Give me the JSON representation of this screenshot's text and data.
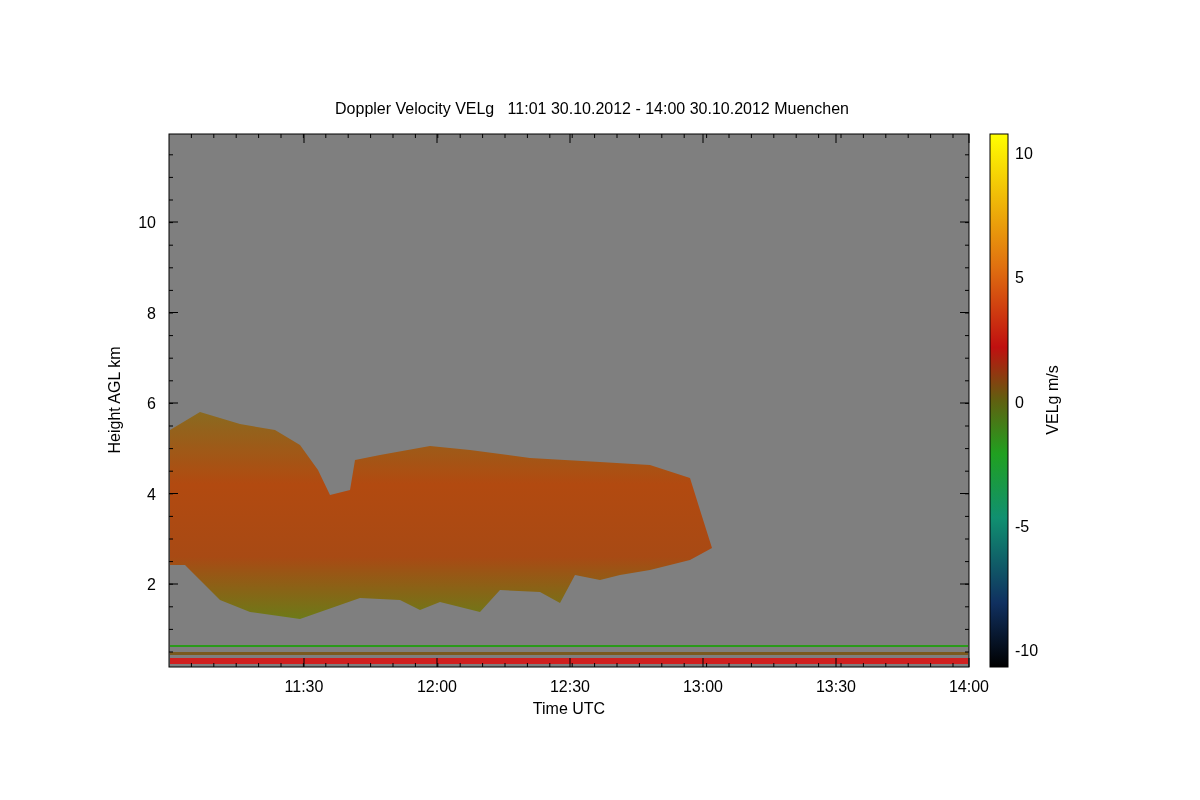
{
  "plot": {
    "title": "Doppler Velocity VELg   11:01 30.10.2012 - 14:00 30.10.2012 Muenchen",
    "x_axis": {
      "label": "Time UTC",
      "ticks": [
        "11:30",
        "12:00",
        "12:30",
        "13:00",
        "13:30",
        "14:00"
      ]
    },
    "y_axis": {
      "label": "Height AGL km",
      "ticks": [
        "10",
        "8",
        "6",
        "4",
        "2"
      ]
    },
    "colorbar": {
      "label": "VELg m/s",
      "ticks": [
        "10",
        "5",
        "0",
        "-5",
        "-10"
      ]
    }
  }
}
